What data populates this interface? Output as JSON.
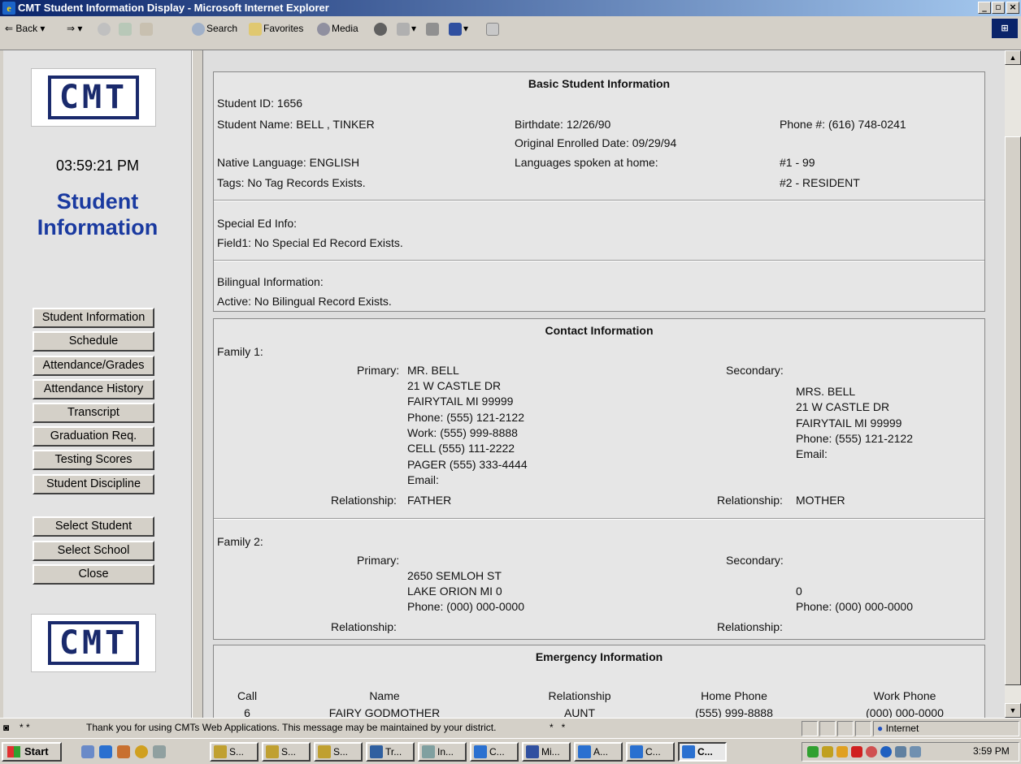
{
  "window": {
    "title": "CMT Student Information Display - Microsoft Internet Explorer",
    "min": "_",
    "max": "▫",
    "close": "×"
  },
  "toolbar": {
    "back": "Back",
    "search": "Search",
    "favorites": "Favorites",
    "media": "Media"
  },
  "sidebar": {
    "logo_text": "CMT",
    "clock": "03:59:21 PM",
    "app_title_1": "Student",
    "app_title_2": "Information",
    "nav": [
      "Student Information",
      "Schedule",
      "Attendance/Grades",
      "Attendance History",
      "Transcript",
      "Graduation Req.",
      "Testing Scores",
      "Student Discipline"
    ],
    "actions": [
      "Select Student",
      "Select School",
      "Close"
    ]
  },
  "basic": {
    "header": "Basic Student Information",
    "student_id": "Student ID: 1656",
    "student_name": "Student Name: BELL , TINKER",
    "birthdate": "Birthdate: 12/26/90",
    "phone": "Phone #: (616) 748-0241",
    "enrolled": "Original Enrolled Date: 09/29/94",
    "native_language": "Native Language: ENGLISH",
    "languages_home": "Languages spoken at home:",
    "lang1": "#1 - 99",
    "tags": "Tags: No Tag Records Exists.",
    "lang2": "#2 - RESIDENT",
    "special_ed_label": "Special Ed Info:",
    "special_ed_field": "Field1: No Special Ed Record Exists.",
    "bilingual_label": "Bilingual Information:",
    "bilingual_active": "Active: No Bilingual Record Exists."
  },
  "contact": {
    "header": "Contact Information",
    "family1": {
      "label": "Family 1:",
      "primary_label": "Primary:",
      "primary_name": "MR. BELL",
      "primary_lines": [
        "21 W CASTLE DR",
        "FAIRYTAIL MI 99999",
        "Phone: (555) 121-2122",
        "Work: (555) 999-8888",
        "CELL (555) 111-2222",
        "PAGER (555) 333-4444",
        "Email:"
      ],
      "secondary_label": "Secondary:",
      "secondary_lines": [
        "MRS. BELL",
        "21 W CASTLE DR",
        "FAIRYTAIL MI 99999",
        "Phone: (555) 121-2122",
        "Email:"
      ],
      "relationship_label": "Relationship:",
      "primary_relationship": "FATHER",
      "secondary_relationship": "MOTHER"
    },
    "family2": {
      "label": "Family 2:",
      "primary_label": "Primary:",
      "primary_lines": [
        "2650 SEMLOH ST",
        "LAKE ORION MI 0",
        "Phone: (000) 000-0000"
      ],
      "secondary_label": "Secondary:",
      "secondary_lines": [
        "0",
        "Phone: (000) 000-0000"
      ],
      "relationship_label": "Relationship:"
    }
  },
  "emergency": {
    "header": "Emergency Information",
    "columns": [
      "Call",
      "Name",
      "Relationship",
      "Home Phone",
      "Work Phone"
    ],
    "row": [
      "6",
      "FAIRY GODMOTHER",
      "AUNT",
      "(555) 999-8888",
      "(000) 000-0000"
    ]
  },
  "status": {
    "icon_text": "* *",
    "message": "Thank you for using CMTs Web Applications.  This message may be maintained by your district.",
    "stars": "*   *",
    "zone": "Internet"
  },
  "taskbar": {
    "start": "Start",
    "tasks": [
      "S...",
      "S...",
      "S...",
      "Tr...",
      "In...",
      "C...",
      "Mi...",
      "A...",
      "C...",
      "C..."
    ],
    "time": "3:59 PM"
  }
}
